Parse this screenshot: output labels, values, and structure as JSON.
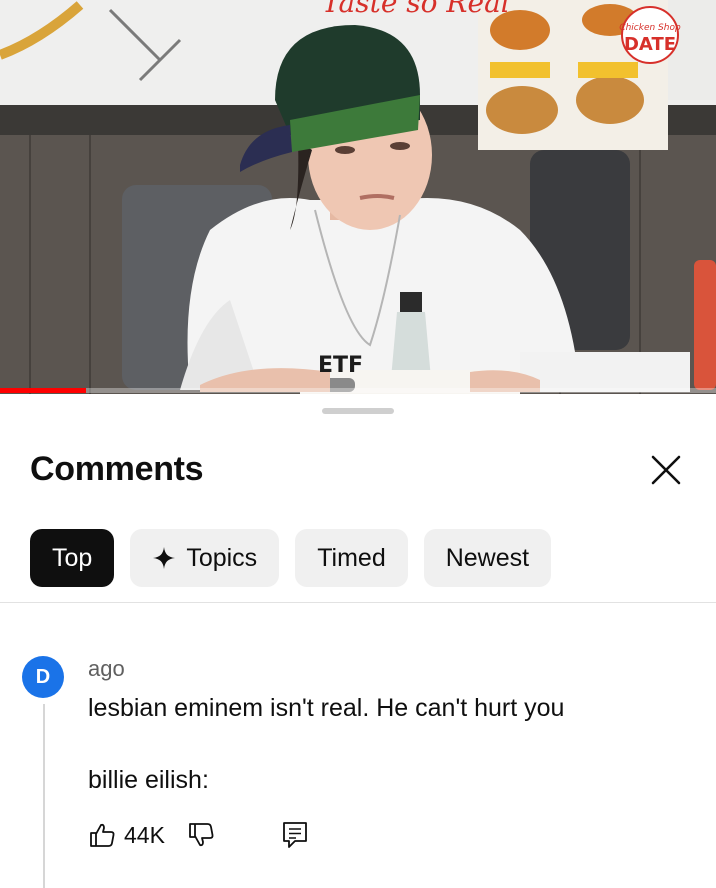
{
  "video": {
    "progress": 0.12,
    "progress_color": "#ff0000",
    "sign_text": "Taste so Real",
    "logo_text": "Chicken Shop DATE"
  },
  "sheet": {
    "title": "Comments",
    "filters": [
      {
        "label": "Top",
        "active": true,
        "icon": ""
      },
      {
        "label": "Topics",
        "active": false,
        "icon": "sparkle-icon"
      },
      {
        "label": "Timed",
        "active": false,
        "icon": ""
      },
      {
        "label": "Newest",
        "active": false,
        "icon": ""
      }
    ]
  },
  "comment": {
    "avatar_letter": "D",
    "author": "",
    "time_suffix": "ago",
    "text": "lesbian eminem isn't real. He can't hurt you\n\nbillie eilish:",
    "likes": "44K"
  }
}
